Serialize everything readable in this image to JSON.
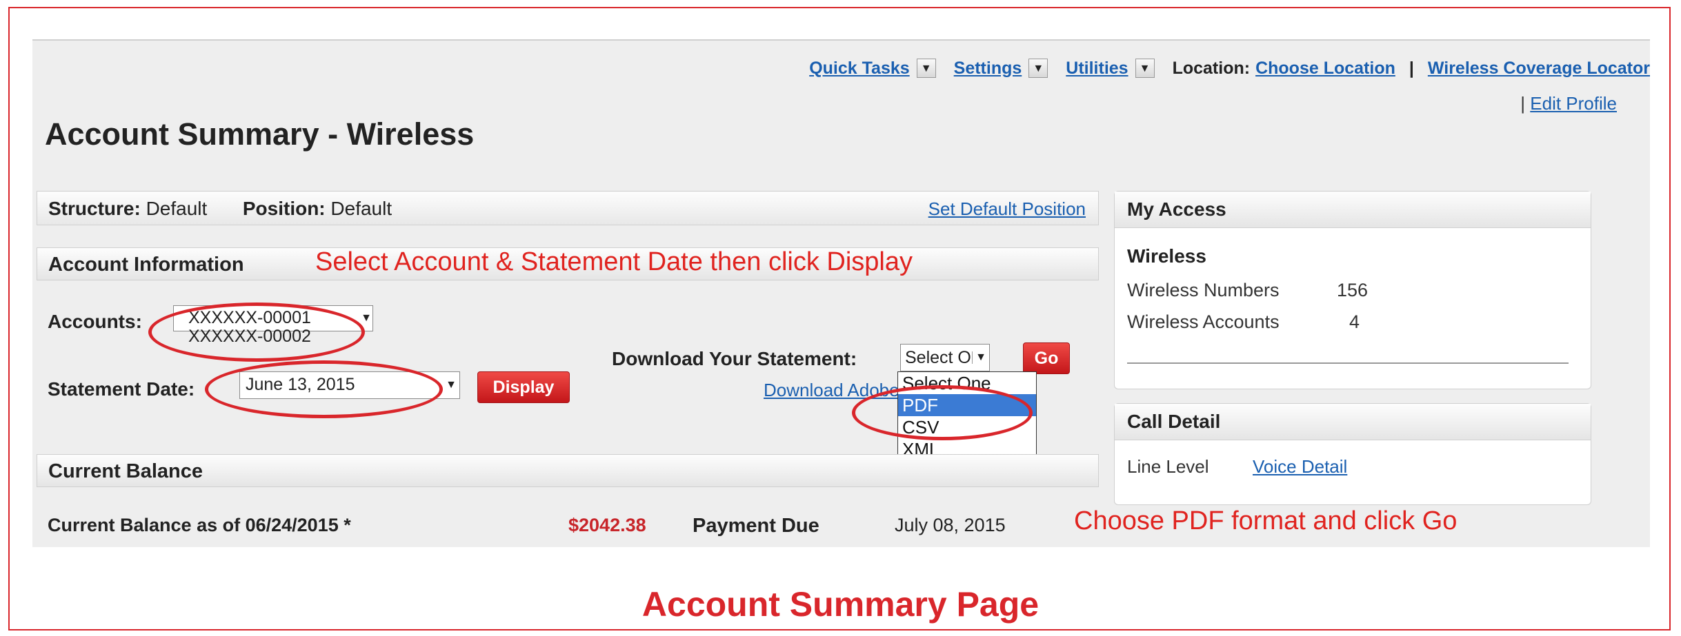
{
  "nav": {
    "quick_tasks": "Quick Tasks",
    "settings": "Settings",
    "utilities": "Utilities",
    "location_label": "Location:",
    "choose_location": "Choose Location",
    "separator": "|",
    "coverage": "Wireless Coverage Locator",
    "dropdown_glyph": "▼"
  },
  "edit_profile": {
    "bar": "|",
    "label": "Edit Profile"
  },
  "page_title": "Account Summary - Wireless",
  "structure": {
    "structure_label": "Structure:",
    "structure_value": "Default",
    "position_label": "Position:",
    "position_value": "Default",
    "set_default": "Set Default Position"
  },
  "account_info": {
    "heading": "Account Information",
    "annotation": "Select Account & Statement Date then click Display",
    "accounts_label": "Accounts:",
    "accounts": [
      "XXXXXX-00001",
      "XXXXXX-00002"
    ],
    "statement_label": "Statement Date:",
    "statement_value": "June 13, 2015",
    "display_button": "Display",
    "download_label": "Download Your Statement:",
    "download_selected": "Select One",
    "go_button": "Go",
    "download_link": "Download Adobe Reader",
    "download_options": [
      "Select One",
      "PDF",
      "CSV",
      "XML"
    ],
    "highlighted_option": "PDF"
  },
  "current_balance": {
    "heading": "Current Balance",
    "label": "Current Balance as of 06/24/2015 *",
    "amount": "$2042.38",
    "payment_label": "Payment Due",
    "payment_date": "July 08, 2015"
  },
  "my_access": {
    "heading": "My Access",
    "section": "Wireless",
    "rows": [
      {
        "label": "Wireless Numbers",
        "value": "156"
      },
      {
        "label": "Wireless Accounts",
        "value": "4"
      }
    ]
  },
  "call_detail": {
    "heading": "Call Detail",
    "line_level": "Line Level",
    "voice_detail": "Voice Detail"
  },
  "annotations": {
    "pdf_note": "Choose PDF format and click Go",
    "caption": "Account Summary Page"
  },
  "colors": {
    "accent_red": "#d9262b",
    "link_blue": "#1a5fb0",
    "highlight": "#3b7bd4"
  }
}
